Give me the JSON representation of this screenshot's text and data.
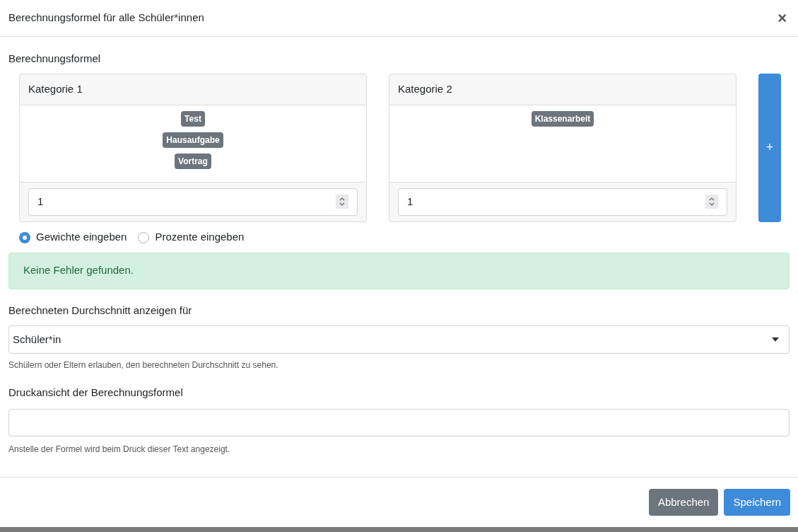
{
  "dialog": {
    "title": "Berechnungsformel für alle Schüler*innen",
    "close": "×"
  },
  "formula": {
    "label": "Berechnungsformel",
    "categories": [
      {
        "title": "Kategorie 1",
        "tags": [
          "Test",
          "Hausaufgabe",
          "Vortrag"
        ],
        "weight": "1"
      },
      {
        "title": "Kategorie 2",
        "tags": [
          "Klassenarbeit"
        ],
        "weight": "1"
      }
    ],
    "add_button": "+"
  },
  "modes": [
    {
      "label": "Gewichte eingeben",
      "selected": true
    },
    {
      "label": "Prozente eingeben",
      "selected": false
    }
  ],
  "alert": "Keine Fehler gefunden.",
  "average": {
    "label": "Berechneten Durchschnitt anzeigen für",
    "value": "Schüler*in",
    "help": "Schülern oder Eltern erlauben, den berechneten Durchschnitt zu sehen."
  },
  "print_view": {
    "label": "Druckansicht der Berechnungsformel",
    "help": "Anstelle der Formel wird beim Druck dieser Text angezeigt."
  },
  "buttons": [
    {
      "label": "Abbrechen",
      "kind": "secondary"
    },
    {
      "label": "Speichern",
      "kind": "primary"
    }
  ]
}
